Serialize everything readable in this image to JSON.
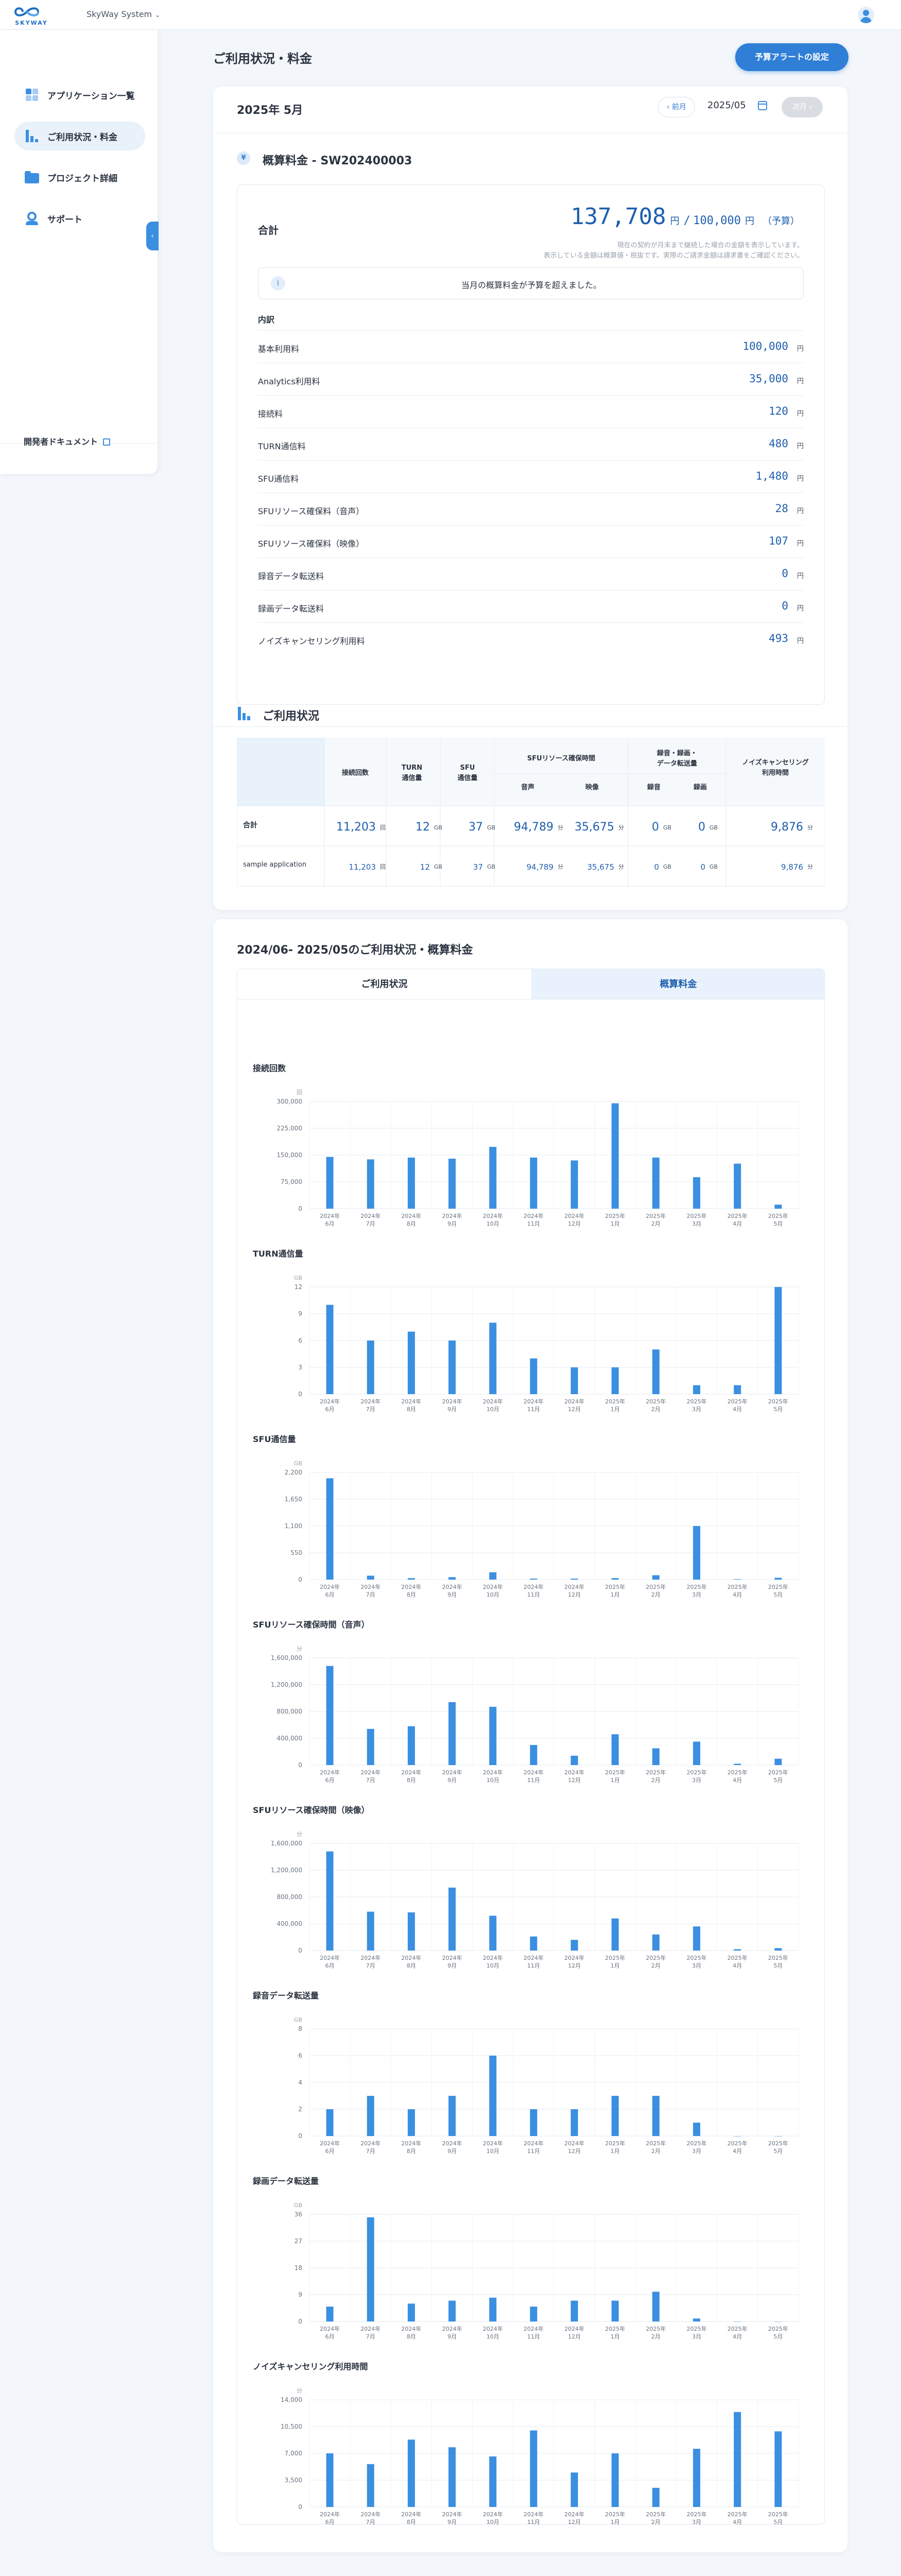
{
  "header": {
    "logo_text": "SKYWAY",
    "system_name": "SkyWay System",
    "user_icon": "user-avatar-icon"
  },
  "sidebar": {
    "items": [
      {
        "label": "アプリケーション一覧",
        "icon": "apps-grid-icon",
        "active": false
      },
      {
        "label": "ご利用状況・料金",
        "icon": "bar-chart-icon",
        "active": true
      },
      {
        "label": "プロジェクト詳細",
        "icon": "folder-icon",
        "active": false
      },
      {
        "label": "サポート",
        "icon": "support-icon",
        "active": false
      }
    ],
    "dev_doc_label": "開発者ドキュメント",
    "collapse_icon": "‹"
  },
  "page": {
    "title": "ご利用状況・料金",
    "alert_button": "予算アラートの設定"
  },
  "billing": {
    "month_label": "2025年 5月",
    "prev_label": "‹ 前月",
    "month_value": "2025/05",
    "next_label": "次月 ›",
    "invoice_title": "概算料金 - SW202400003",
    "total_label": "合計",
    "total_amount": "137,708",
    "total_unit": "円",
    "budget_sep": "/",
    "budget_amount": "100,000",
    "budget_unit": "円",
    "budget_tag": "（予算）",
    "note_line1": "現在の契約が月末まで継続した場合の金額を表示しています。",
    "note_line2": "表示している金額は概算値・税抜です。実際のご請求金額は請求書をご確認ください。",
    "over_budget_message": "当月の概算料金が予算を超えました。",
    "breakdown_heading": "内訳",
    "breakdown": [
      {
        "name": "基本利用料",
        "value": "100,000",
        "unit": "円"
      },
      {
        "name": "Analytics利用料",
        "value": "35,000",
        "unit": "円"
      },
      {
        "name": "接続料",
        "value": "120",
        "unit": "円"
      },
      {
        "name": "TURN通信料",
        "value": "480",
        "unit": "円"
      },
      {
        "name": "SFU通信料",
        "value": "1,480",
        "unit": "円"
      },
      {
        "name": "SFUリソース確保料（音声）",
        "value": "28",
        "unit": "円"
      },
      {
        "name": "SFUリソース確保料（映像）",
        "value": "107",
        "unit": "円"
      },
      {
        "name": "録音データ転送料",
        "value": "0",
        "unit": "円"
      },
      {
        "name": "録画データ転送料",
        "value": "0",
        "unit": "円"
      },
      {
        "name": "ノイズキャンセリング利用料",
        "value": "493",
        "unit": "円"
      }
    ]
  },
  "usage": {
    "title": "ご利用状況",
    "headers": {
      "connections": "接続回数",
      "turn": "TURN\n通信量",
      "sfu": "SFU\n通信量",
      "sfu_resource": "SFUリソース確保時間",
      "audio": "音声",
      "video": "映像",
      "recording": "録音・録画・\nデータ転送量",
      "rec_audio": "録音",
      "rec_video": "録画",
      "noise": "ノイズキャンセリング\n利用時間"
    },
    "rows": [
      {
        "name": "合計",
        "connections": "11,203",
        "connections_unit": "回",
        "turn": "12",
        "turn_unit": "GB",
        "sfu": "37",
        "sfu_unit": "GB",
        "audio": "94,789",
        "audio_unit": "分",
        "video": "35,675",
        "video_unit": "分",
        "rec_audio": "0",
        "rec_audio_unit": "GB",
        "rec_video": "0",
        "rec_video_unit": "GB",
        "noise": "9,876",
        "noise_unit": "分"
      },
      {
        "name": "sample application",
        "connections": "11,203",
        "connections_unit": "回",
        "turn": "12",
        "turn_unit": "GB",
        "sfu": "37",
        "sfu_unit": "GB",
        "audio": "94,789",
        "audio_unit": "分",
        "video": "35,675",
        "video_unit": "分",
        "rec_audio": "0",
        "rec_audio_unit": "GB",
        "rec_video": "0",
        "rec_video_unit": "GB",
        "noise": "9,876",
        "noise_unit": "分"
      }
    ]
  },
  "history": {
    "title": "2024/06- 2025/05のご利用状況・概算料金",
    "tab_usage": "ご利用状況",
    "tab_fee": "概算料金"
  },
  "chart_data": [
    {
      "type": "bar",
      "title": "接続回数",
      "unit": "回",
      "categories": [
        "2024年 6月",
        "2024年 7月",
        "2024年 8月",
        "2024年 9月",
        "2024年 10月",
        "2024年 11月",
        "2024年 12月",
        "2025年 1月",
        "2025年 2月",
        "2025年 3月",
        "2025年 4月",
        "2025年 5月"
      ],
      "ticks": [
        "0",
        "75,000",
        "150,000",
        "225,000",
        "300,000"
      ],
      "ylim": [
        0,
        300000
      ],
      "values": [
        145000,
        138000,
        143000,
        140000,
        173000,
        143000,
        135000,
        295000,
        143000,
        88000,
        126000,
        11203
      ]
    },
    {
      "type": "bar",
      "title": "TURN通信量",
      "unit": "GB",
      "categories": [
        "2024年 6月",
        "2024年 7月",
        "2024年 8月",
        "2024年 9月",
        "2024年 10月",
        "2024年 11月",
        "2024年 12月",
        "2025年 1月",
        "2025年 2月",
        "2025年 3月",
        "2025年 4月",
        "2025年 5月"
      ],
      "ticks": [
        "0",
        "3",
        "6",
        "9",
        "12"
      ],
      "ylim": [
        0,
        12
      ],
      "values": [
        10,
        6,
        7,
        6,
        8,
        4,
        3,
        3,
        5,
        1,
        1,
        12
      ]
    },
    {
      "type": "bar",
      "title": "SFU通信量",
      "unit": "GB",
      "categories": [
        "2024年 6月",
        "2024年 7月",
        "2024年 8月",
        "2024年 9月",
        "2024年 10月",
        "2024年 11月",
        "2024年 12月",
        "2025年 1月",
        "2025年 2月",
        "2025年 3月",
        "2025年 4月",
        "2025年 5月"
      ],
      "ticks": [
        "0",
        "550",
        "1,100",
        "1,650",
        "2,200"
      ],
      "ylim": [
        0,
        2200
      ],
      "values": [
        2080,
        80,
        30,
        50,
        150,
        20,
        20,
        30,
        90,
        1100,
        10,
        37
      ]
    },
    {
      "type": "bar",
      "title": "SFUリソース確保時間（音声）",
      "unit": "分",
      "categories": [
        "2024年 6月",
        "2024年 7月",
        "2024年 8月",
        "2024年 9月",
        "2024年 10月",
        "2024年 11月",
        "2024年 12月",
        "2025年 1月",
        "2025年 2月",
        "2025年 3月",
        "2025年 4月",
        "2025年 5月"
      ],
      "ticks": [
        "0",
        "400,000",
        "800,000",
        "1,200,000",
        "1,600,000"
      ],
      "ylim": [
        0,
        1600000
      ],
      "values": [
        1480000,
        540000,
        580000,
        940000,
        870000,
        300000,
        140000,
        460000,
        250000,
        350000,
        20000,
        94789
      ]
    },
    {
      "type": "bar",
      "title": "SFUリソース確保時間（映像）",
      "unit": "分",
      "categories": [
        "2024年 6月",
        "2024年 7月",
        "2024年 8月",
        "2024年 9月",
        "2024年 10月",
        "2024年 11月",
        "2024年 12月",
        "2025年 1月",
        "2025年 2月",
        "2025年 3月",
        "2025年 4月",
        "2025年 5月"
      ],
      "ticks": [
        "0",
        "400,000",
        "800,000",
        "1,200,000",
        "1,600,000"
      ],
      "ylim": [
        0,
        1600000
      ],
      "values": [
        1480000,
        580000,
        570000,
        940000,
        520000,
        210000,
        160000,
        480000,
        240000,
        360000,
        20000,
        35675
      ]
    },
    {
      "type": "bar",
      "title": "録音データ転送量",
      "unit": "GB",
      "categories": [
        "2024年 6月",
        "2024年 7月",
        "2024年 8月",
        "2024年 9月",
        "2024年 10月",
        "2024年 11月",
        "2024年 12月",
        "2025年 1月",
        "2025年 2月",
        "2025年 3月",
        "2025年 4月",
        "2025年 5月"
      ],
      "ticks": [
        "0",
        "2",
        "4",
        "6",
        "8"
      ],
      "ylim": [
        0,
        8
      ],
      "values": [
        2,
        3,
        2,
        3,
        6,
        2,
        2,
        3,
        3,
        1,
        0,
        0
      ]
    },
    {
      "type": "bar",
      "title": "録画データ転送量",
      "unit": "GB",
      "categories": [
        "2024年 6月",
        "2024年 7月",
        "2024年 8月",
        "2024年 9月",
        "2024年 10月",
        "2024年 11月",
        "2024年 12月",
        "2025年 1月",
        "2025年 2月",
        "2025年 3月",
        "2025年 4月",
        "2025年 5月"
      ],
      "ticks": [
        "0",
        "9",
        "18",
        "27",
        "36"
      ],
      "ylim": [
        0,
        36
      ],
      "values": [
        5,
        35,
        6,
        7,
        8,
        5,
        7,
        7,
        10,
        1,
        0,
        0
      ]
    },
    {
      "type": "bar",
      "title": "ノイズキャンセリング利用時間",
      "unit": "分",
      "categories": [
        "2024年 6月",
        "2024年 7月",
        "2024年 8月",
        "2024年 9月",
        "2024年 10月",
        "2024年 11月",
        "2024年 12月",
        "2025年 1月",
        "2025年 2月",
        "2025年 3月",
        "2025年 4月",
        "2025年 5月"
      ],
      "ticks": [
        "0",
        "3,500",
        "7,000",
        "10,500",
        "14,000"
      ],
      "ylim": [
        0,
        14000
      ],
      "values": [
        7000,
        5600,
        8800,
        7800,
        6600,
        10000,
        4500,
        7000,
        2500,
        7600,
        12400,
        9876
      ]
    }
  ],
  "colors": {
    "accent": "#2f7fd6",
    "bar": "#3b8fe0",
    "text": "#2b3340",
    "amount": "#1f5fae"
  }
}
